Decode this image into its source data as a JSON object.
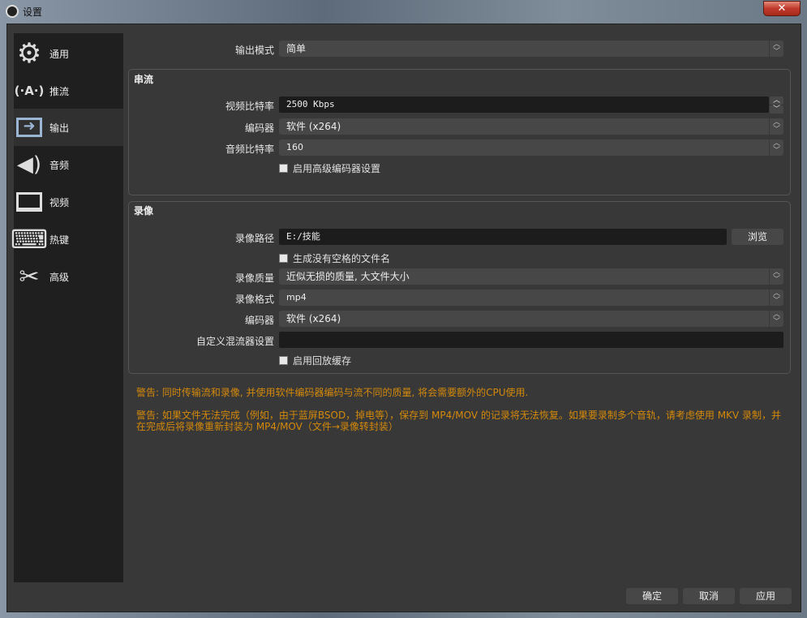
{
  "window": {
    "title": "设置",
    "close": "✕"
  },
  "sidebar": {
    "items": [
      {
        "label": "通用",
        "icon": "gear-icon",
        "glyph": "⚙"
      },
      {
        "label": "推流",
        "icon": "antenna-icon",
        "glyph": "📡"
      },
      {
        "label": "输出",
        "icon": "monitor-arrow-icon",
        "glyph": "⇨"
      },
      {
        "label": "音频",
        "icon": "speaker-icon",
        "glyph": "🔊"
      },
      {
        "label": "视频",
        "icon": "monitor-icon",
        "glyph": "🖥"
      },
      {
        "label": "热键",
        "icon": "keyboard-icon",
        "glyph": "⌨"
      },
      {
        "label": "高级",
        "icon": "tools-icon",
        "glyph": "✂"
      }
    ],
    "selected": 2
  },
  "output_mode": {
    "label": "输出模式",
    "value": "简单"
  },
  "streaming": {
    "title": "串流",
    "video_bitrate": {
      "label": "视频比特率",
      "value": "2500 Kbps"
    },
    "encoder": {
      "label": "编码器",
      "value": "软件 (x264)"
    },
    "audio_bitrate": {
      "label": "音频比特率",
      "value": "160"
    },
    "advanced_checkbox": {
      "label": "启用高级编码器设置",
      "checked": false
    }
  },
  "recording": {
    "title": "录像",
    "path": {
      "label": "录像路径",
      "value": "E:/技能",
      "browse": "浏览"
    },
    "no_space_checkbox": {
      "label": "生成没有空格的文件名",
      "checked": false
    },
    "quality": {
      "label": "录像质量",
      "value": "近似无损的质量, 大文件大小"
    },
    "format": {
      "label": "录像格式",
      "value": "mp4"
    },
    "encoder": {
      "label": "编码器",
      "value": "软件 (x264)"
    },
    "muxer": {
      "label": "自定义混流器设置",
      "value": ""
    },
    "replay_checkbox": {
      "label": "启用回放缓存",
      "checked": false
    }
  },
  "warnings": [
    "警告: 同时传输流和录像, 并使用软件编码器编码与流不同的质量, 将会需要额外的CPU使用.",
    "警告: 如果文件无法完成（例如，由于蓝屏BSOD，掉电等），保存到 MP4/MOV 的记录将无法恢复。如果要录制多个音轨，请考虑使用 MKV 录制，并在完成后将录像重新封装为 MP4/MOV（文件→录像转封装）"
  ],
  "buttons": {
    "ok": "确定",
    "cancel": "取消",
    "apply": "应用"
  },
  "colors": {
    "warning": "#d4890a",
    "sidebar": "#1f1f1f",
    "panel": "#383838"
  }
}
